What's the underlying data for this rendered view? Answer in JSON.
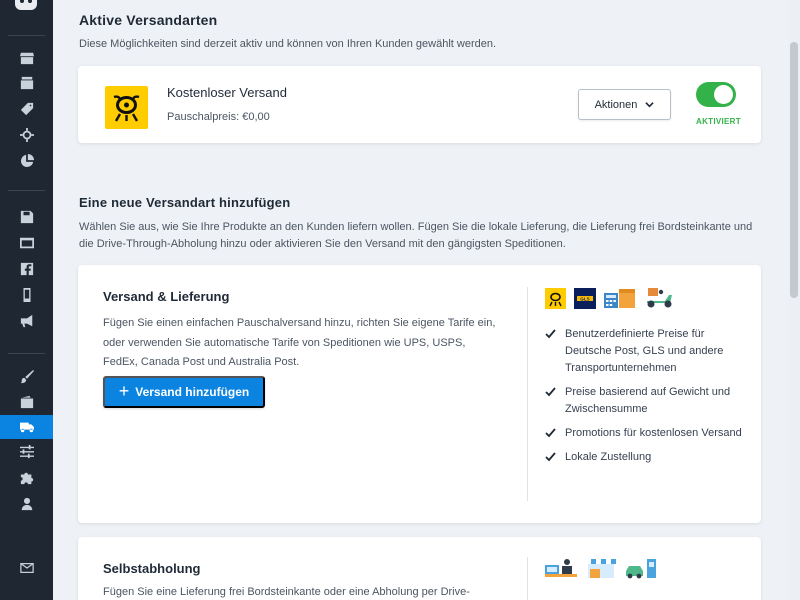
{
  "active_section": {
    "title": "Aktive Versandarten",
    "subtitle": "Diese Möglichkeiten sind derzeit aktiv und können von Ihren Kunden gewählt werden.",
    "shipping": {
      "name": "Kostenloser Versand",
      "price": "Pauschalpreis: €0,00",
      "actions_label": "Aktionen",
      "status_label": "AKTIVIERT",
      "enabled": true,
      "accent_color": "#34b24a"
    }
  },
  "add_section": {
    "title": "Eine neue Versandart hinzufügen",
    "description": "Wählen Sie aus, wie Sie Ihre Produkte an den Kunden liefern wollen. Fügen Sie die lokale Lieferung, die Lieferung frei Bordsteinkante und die Drive-Through-Abholung hinzu oder aktivieren Sie den Versand mit den gängigsten Speditionen."
  },
  "shipping_card": {
    "title": "Versand & Lieferung",
    "description": "Fügen Sie einen einfachen Pauschalversand hinzu, richten Sie eigene Tarife ein, oder verwenden Sie automatische Tarife von Speditionen wie UPS, USPS, FedEx, Canada Post und Australia Post.",
    "button_label": "Versand hinzufügen",
    "carriers": [
      "deutsche-post-icon",
      "gls-icon",
      "calculator-boxes-icon",
      "delivery-scooter-icon"
    ],
    "features": [
      "Benutzerdefinierte Preise für Deutsche Post, GLS und andere Transportunternehmen",
      "Preise basierend auf Gewicht und Zwischensumme",
      "Promotions für kostenlosen Versand",
      "Lokale Zustellung"
    ]
  },
  "pickup_card": {
    "title": "Selbstabholung",
    "description": "Fügen Sie eine Lieferung frei Bordsteinkante oder eine Abholung per Drive-",
    "icons": [
      "pickup-counter-icon",
      "store-front-icon",
      "drive-through-icon"
    ]
  },
  "sidebar": {
    "items": [
      "store-icon",
      "inbox-icon",
      "tag-icon",
      "target-icon",
      "pie-chart-icon",
      "save-icon",
      "browser-icon",
      "facebook-icon",
      "mobile-icon",
      "megaphone-icon",
      "brush-icon",
      "wallet-icon",
      "truck-icon",
      "sliders-icon",
      "puzzle-icon",
      "user-icon",
      "mail-icon"
    ],
    "active": "truck-icon",
    "active_color": "#0a84e0"
  }
}
